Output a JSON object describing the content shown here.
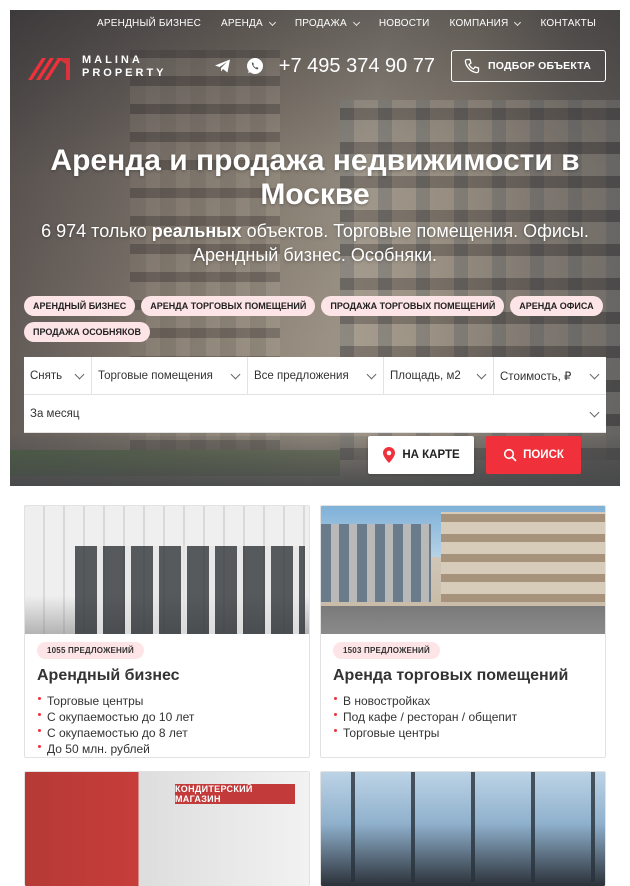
{
  "nav": {
    "items": [
      {
        "label": "Арендный бизнес",
        "dropdown": false
      },
      {
        "label": "Аренда",
        "dropdown": true
      },
      {
        "label": "Продажа",
        "dropdown": true
      },
      {
        "label": "Новости",
        "dropdown": false
      },
      {
        "label": "Компания",
        "dropdown": true
      },
      {
        "label": "Контакты",
        "dropdown": false
      }
    ]
  },
  "brand": {
    "line1": "MALINA",
    "line2": "PROPERTY",
    "accent": "#f0303a"
  },
  "contacts": {
    "phone": "+7 495 374 90 77",
    "pick_button": "Подбор объекта"
  },
  "hero": {
    "title": "Аренда и продажа недвижимости в Москве",
    "sub_count": "6 974",
    "sub_pre": " только ",
    "sub_bold": "реальных",
    "sub_post": " объектов. Торговые помещения. Офисы. Арендный бизнес. Особняки."
  },
  "tags": [
    "Арендный бизнес",
    "Аренда торговых помещений",
    "Продажа торговых помещений",
    "Аренда офиса",
    "Продажа особняков"
  ],
  "filters": {
    "deal": "Снять",
    "type": "Торговые помещения",
    "offers": "Все предложения",
    "area": "Площадь, м2",
    "price": "Стоимость, ₽",
    "period": "За месяц"
  },
  "buttons": {
    "map": "На карте",
    "search": "Поиск"
  },
  "cards": [
    {
      "count": "1055 предложений",
      "title": "Арендный бизнес",
      "items": [
        "Торговые центры",
        "С окупаемостью до 10 лет",
        "С окупаемостью до 8 лет",
        "До 50 млн. рублей"
      ]
    },
    {
      "count": "1503 предложений",
      "title": "Аренда торговых помещений",
      "items": [
        "В новостройках",
        "Под кафе / ресторан / общепит",
        "Торговые центры"
      ]
    },
    {
      "sign": "КОНДИТЕРСКИЙ МАГАЗИН"
    },
    {}
  ]
}
